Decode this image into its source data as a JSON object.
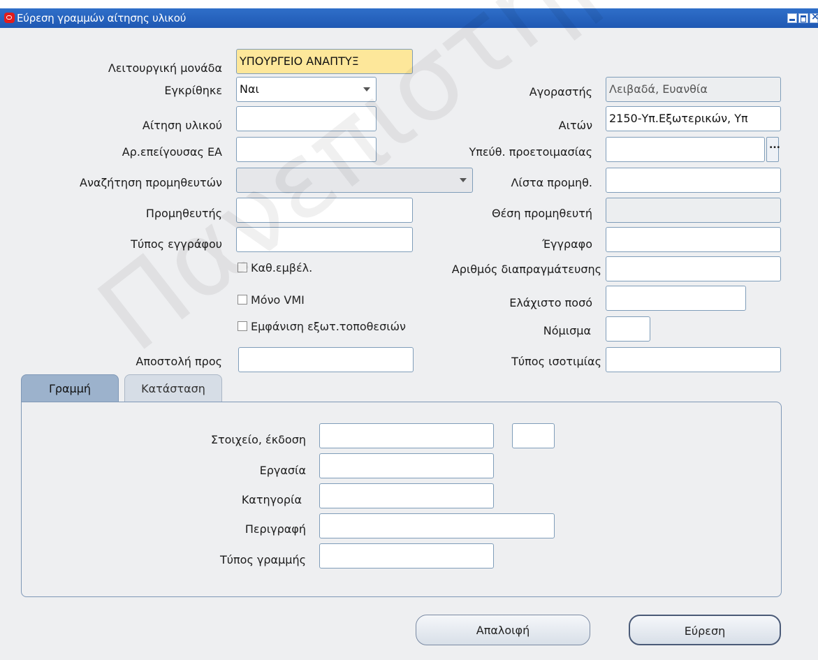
{
  "window": {
    "title": "Εύρεση γραμμών αίτησης υλικού"
  },
  "form": {
    "operating_unit": {
      "label": "Λειτουργική μονάδα",
      "value": "ΥΠΟΥΡΓΕΙΟ ΑΝΑΠΤΥΞ"
    },
    "approved": {
      "label": "Εγκρίθηκε",
      "value": "Ναι"
    },
    "buyer": {
      "label": "Αγοραστής",
      "value": "Λειβαδά, Ευανθία"
    },
    "requisition": {
      "label": "Αίτηση υλικού",
      "value": ""
    },
    "requester": {
      "label": "Αιτών",
      "value": "2150-Υπ.Εξωτερικών, Υπ"
    },
    "emergency_po": {
      "label": "Αρ.επείγουσας ΕΑ",
      "value": ""
    },
    "preparer": {
      "label": "Υπεύθ. προετοιμασίας",
      "value": ""
    },
    "supplier_search": {
      "label": "Αναζήτηση προμηθευτών",
      "value": ""
    },
    "supplier_list": {
      "label": "Λίστα προμηθ.",
      "value": ""
    },
    "supplier": {
      "label": "Προμηθευτής",
      "value": ""
    },
    "supplier_site": {
      "label": "Θέση προμηθευτή",
      "value": ""
    },
    "document_type": {
      "label": "Τύπος εγγράφου",
      "value": ""
    },
    "document": {
      "label": "Έγγραφο",
      "value": ""
    },
    "in_range": {
      "label": "Καθ.εμβέλ."
    },
    "negotiation_number": {
      "label": "Αριθμός διαπραγμάτευσης",
      "value": ""
    },
    "vmi_only": {
      "label": "Μόνο VMI"
    },
    "min_amount": {
      "label": "Ελάχιστο ποσό",
      "value": ""
    },
    "show_external": {
      "label": "Εμφάνιση εξωτ.τοποθεσιών"
    },
    "currency": {
      "label": "Νόμισμα",
      "value": ""
    },
    "ship_to": {
      "label": "Αποστολή προς",
      "value": ""
    },
    "rate_type": {
      "label": "Τύπος ισοτιμίας",
      "value": ""
    }
  },
  "tabs": {
    "line": "Γραμμή",
    "status": "Κατάσταση"
  },
  "line_panel": {
    "item_revision": {
      "label": "Στοιχείο, έκδοση",
      "value": ""
    },
    "job": {
      "label": "Εργασία",
      "value": ""
    },
    "category": {
      "label": "Κατηγορία",
      "value": ""
    },
    "description": {
      "label": "Περιγραφή",
      "value": ""
    },
    "line_type": {
      "label": "Τύπος γραμμής",
      "value": ""
    }
  },
  "buttons": {
    "clear": "Απαλοιφή",
    "find": "Εύρεση"
  },
  "watermark": {
    "text": "Πανεπιστήμιο Πειραιώς"
  }
}
